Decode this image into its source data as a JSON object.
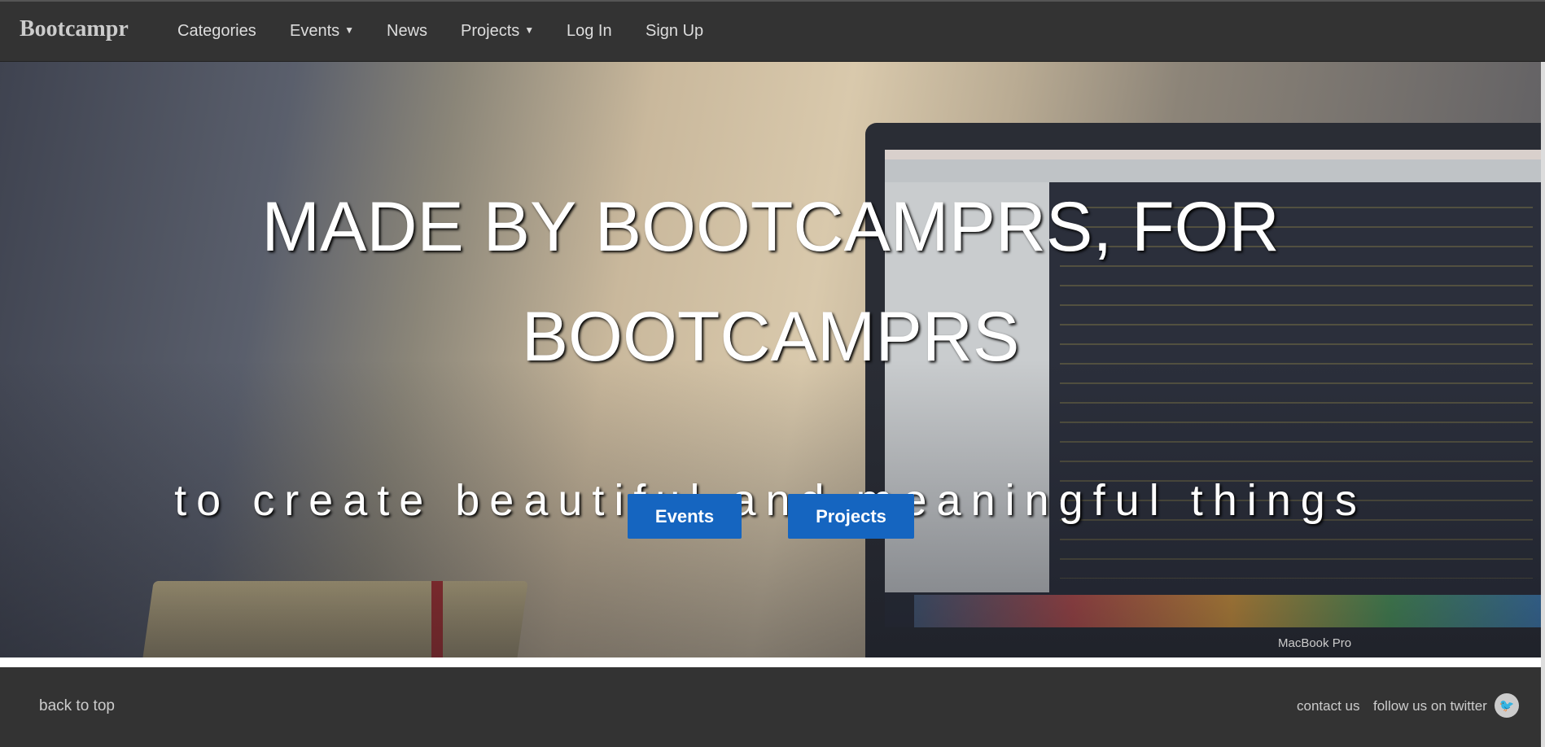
{
  "nav": {
    "brand": "Bootcampr",
    "items": [
      {
        "label": "Categories",
        "dropdown": false
      },
      {
        "label": "Events",
        "dropdown": true
      },
      {
        "label": "News",
        "dropdown": false
      },
      {
        "label": "Projects",
        "dropdown": true
      },
      {
        "label": "Log In",
        "dropdown": false
      },
      {
        "label": "Sign Up",
        "dropdown": false
      }
    ],
    "caret": "▼"
  },
  "hero": {
    "line1": "MADE BY BOOTCAMPRS, FOR",
    "line2": "BOOTCAMPRS",
    "subtitle": "to create beautiful and meaningful things",
    "buttons": {
      "events": "Events",
      "projects": "Projects"
    },
    "button_color": "#1565c0",
    "laptop_label": "MacBook Pro"
  },
  "footer": {
    "back_to_top": "back to top",
    "contact": "contact us",
    "twitter": "follow us on twitter",
    "twitter_icon": "twitter-bird-icon"
  }
}
